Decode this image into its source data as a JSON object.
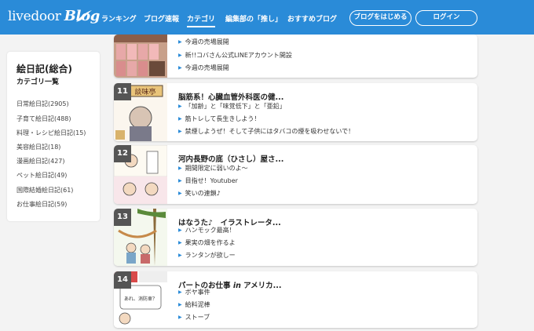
{
  "header": {
    "logo_text": "livedoor",
    "logo_blog": "Blog",
    "nav": [
      "ランキング",
      "ブログ速報",
      "カテゴリ",
      "編集部の「推し」",
      "おすすめブログ"
    ],
    "start_button": "ブログをはじめる",
    "login_button": "ログイン",
    "brand_color": "#2a8bd8"
  },
  "sidebar": {
    "title": "絵日記(総合)",
    "subtitle": "カテゴリ一覧",
    "items": [
      "日常絵日記(2905)",
      "子育て絵日記(488)",
      "料理・レシピ絵日記(15)",
      "美容絵日記(18)",
      "漫画絵日記(427)",
      "ペット絵日記(49)",
      "国際結婚絵日記(61)",
      "お仕事絵日記(59)"
    ]
  },
  "cards": [
    {
      "rank": "",
      "title": "",
      "items": [
        "今週の売場展開",
        "新!!コバさん公式LINEアカウント開設",
        "今週の売場展開"
      ]
    },
    {
      "rank": "11",
      "title": "脳筋系！心臓血管外科医の健...",
      "items": [
        "「加齢」と「味覚低下」と「亜鉛」",
        "筋トレして長生きしよう！",
        "禁煙しようぜ！そして子供にはタバコの煙を吸わせないで！"
      ]
    },
    {
      "rank": "12",
      "title": "河内長野の底（ひさし）屋さ...",
      "items": [
        "期間限定に弱いのよ～",
        "目指せ！Youtuber",
        "笑いの連鎖♪"
      ]
    },
    {
      "rank": "13",
      "title": "はなうた♪　イラストレータ...",
      "items": [
        "ハンモック最高！",
        "果実の畑を作るよ",
        "ランタンが欲しー"
      ]
    },
    {
      "rank": "14",
      "title_pre": "パートのお仕事 ",
      "title_em": "in",
      "title_post": " アメリカ...",
      "items": [
        "ボヤ事件",
        "給料泥棒",
        "ストーブ"
      ]
    }
  ],
  "thumb_texts": {
    "sign": "談味亭",
    "bubble": "あれ、消防車？"
  }
}
